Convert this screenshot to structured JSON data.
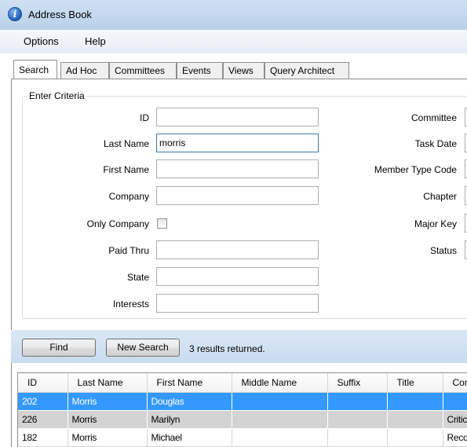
{
  "window": {
    "title": "Address Book"
  },
  "menu": {
    "items": [
      "Options",
      "Help"
    ]
  },
  "tabs": [
    "Search",
    "Ad Hoc",
    "Committees",
    "Events",
    "Views",
    "Query Architect"
  ],
  "criteria": {
    "group_label": "Enter Criteria",
    "left_fields": {
      "id": {
        "label": "ID",
        "value": ""
      },
      "last_name": {
        "label": "Last Name",
        "value": "morris"
      },
      "first_name": {
        "label": "First Name",
        "value": ""
      },
      "company": {
        "label": "Company",
        "value": ""
      },
      "only_company": {
        "label": "Only Company",
        "checked": false
      },
      "paid_thru": {
        "label": "Paid Thru",
        "value": ""
      },
      "state": {
        "label": "State",
        "value": ""
      },
      "interests": {
        "label": "Interests",
        "value": ""
      }
    },
    "right_fields": {
      "committee": {
        "label": "Committee"
      },
      "task_date": {
        "label": "Task Date"
      },
      "member_type_code": {
        "label": "Member Type Code"
      },
      "chapter": {
        "label": "Chapter"
      },
      "major_key": {
        "label": "Major Key"
      },
      "status": {
        "label": "Status"
      }
    }
  },
  "actions": {
    "find_label": "Find",
    "new_search_label": "New Search",
    "status_text": "3 results returned."
  },
  "results": {
    "columns": [
      "ID",
      "Last Name",
      "First Name",
      "Middle Name",
      "Suffix",
      "Title",
      "Com"
    ],
    "rows": [
      [
        "202",
        "Morris",
        "Douglas",
        "",
        "",
        "",
        ""
      ],
      [
        "226",
        "Morris",
        "Marilyn",
        "",
        "",
        "",
        "Critic"
      ],
      [
        "182",
        "Morris",
        "Michael",
        "",
        "",
        "",
        "Reco"
      ]
    ]
  },
  "colors": {
    "titlebar": "#c4d8ee",
    "selection": "#3399ff",
    "row_alt": "#d3d3d3"
  }
}
